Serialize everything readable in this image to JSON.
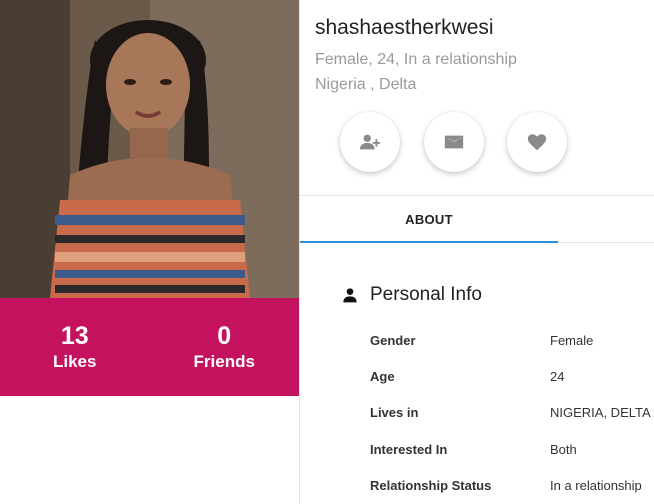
{
  "profile": {
    "username": "shashaestherkwesi",
    "summary": "Female, 24, In a relationship",
    "location": "Nigeria , Delta"
  },
  "stats": [
    {
      "value": "13",
      "label": "Likes"
    },
    {
      "value": "0",
      "label": "Friends"
    }
  ],
  "actions": [
    {
      "icon": "add-friend-icon"
    },
    {
      "icon": "mail-icon"
    },
    {
      "icon": "heart-icon"
    }
  ],
  "tabs": [
    {
      "label": "ABOUT",
      "active": true
    }
  ],
  "personal_info": {
    "title": "Personal Info",
    "rows": [
      {
        "key": "Gender",
        "value": "Female"
      },
      {
        "key": "Age",
        "value": "24"
      },
      {
        "key": "Lives in",
        "value": "NIGERIA, DELTA"
      },
      {
        "key": "Interested In",
        "value": "Both"
      },
      {
        "key": "Relationship Status",
        "value": "In a relationship"
      }
    ]
  },
  "colors": {
    "stats_bg": "#c5125e",
    "tab_indicator": "#2e8dd8",
    "icon": "#8a8a8a"
  }
}
